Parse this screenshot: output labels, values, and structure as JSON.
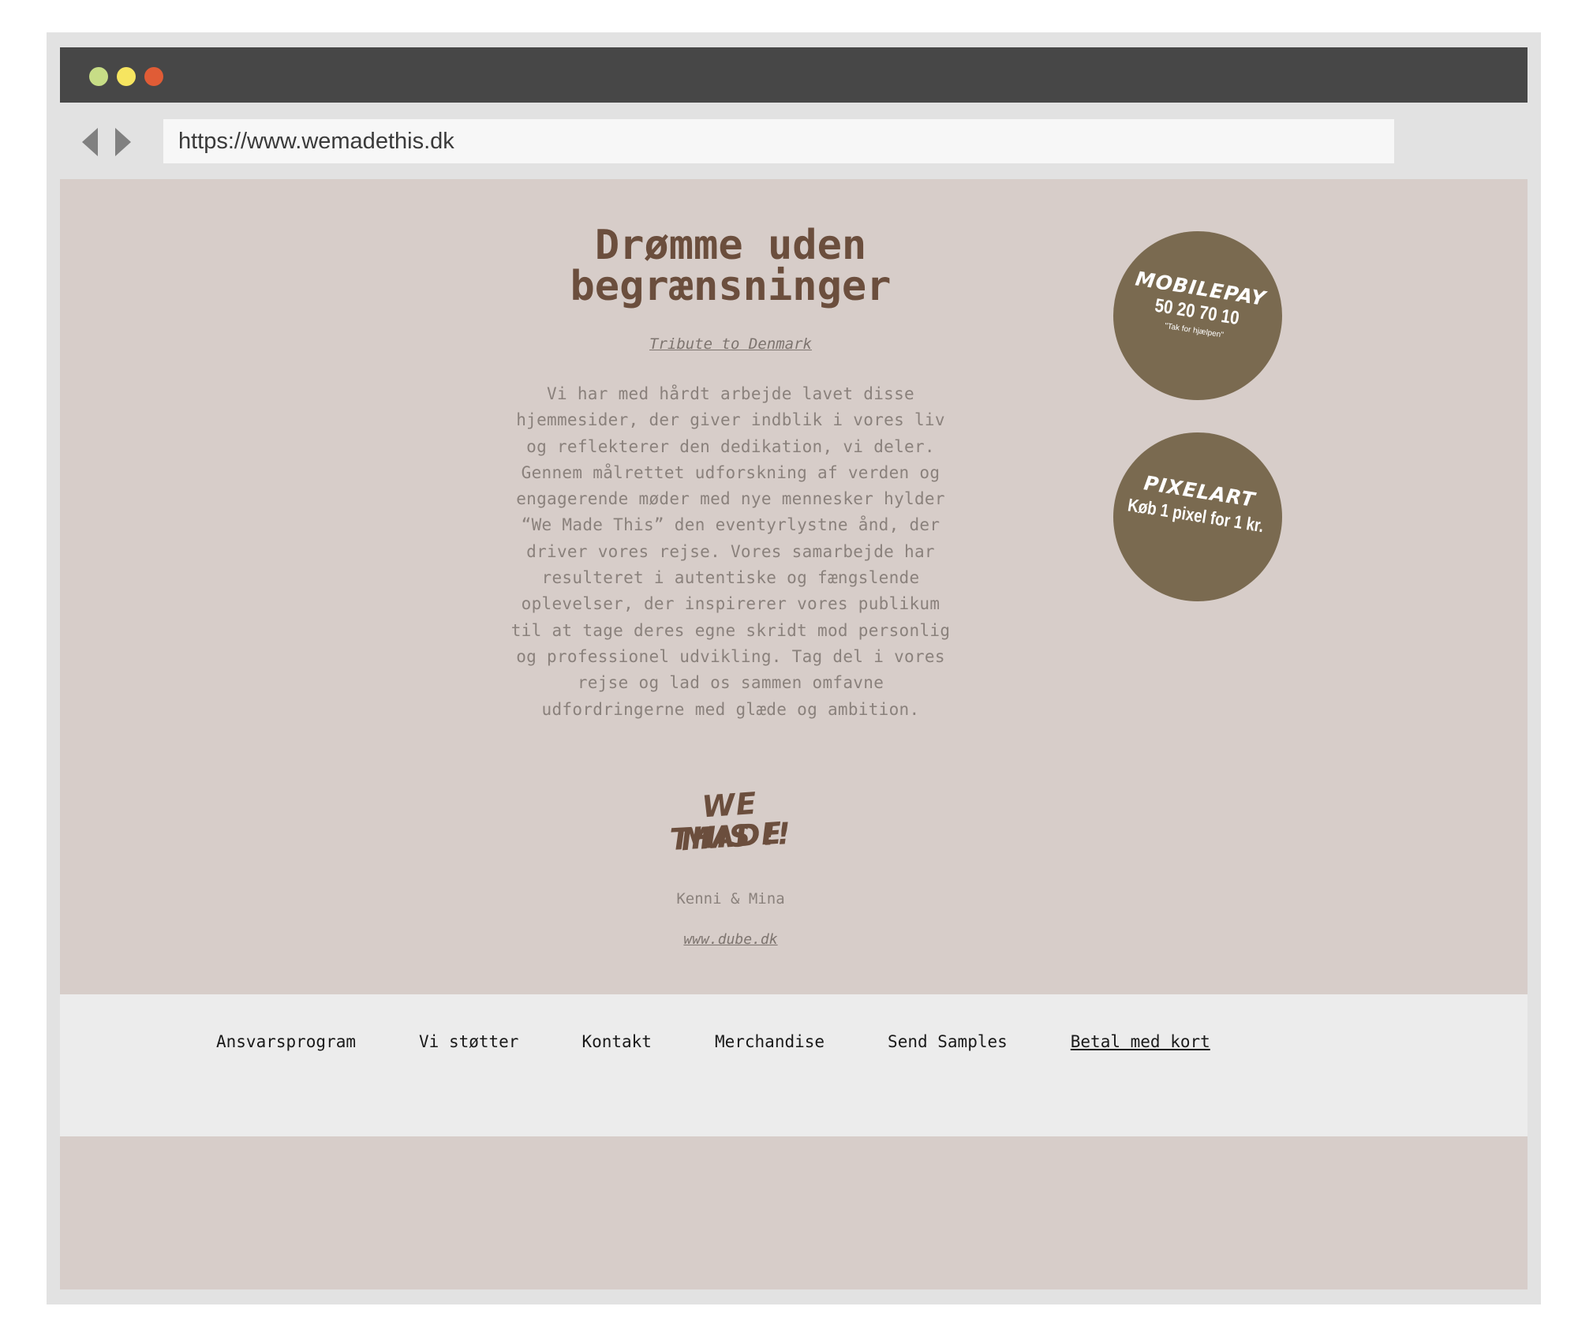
{
  "browser": {
    "url": "https://www.wemadethis.dk",
    "window_dot_colors": [
      "#c7dd86",
      "#f6e560",
      "#e05c36"
    ],
    "nav_icons": [
      "back-arrow-icon",
      "forward-arrow-icon"
    ]
  },
  "hero": {
    "title_line1": "Drømme uden",
    "title_line2": "begrænsninger",
    "subtitle_link": "Tribute to Denmark",
    "body": "Vi har med hårdt arbejde lavet disse hjemmesider, der giver indblik i vores liv og reflekterer den dedikation, vi deler. Gennem målrettet udforskning af verden og engagerende møder med nye mennesker hylder “We Made This” den eventyrlystne ånd, der driver vores rejse. Vores samarbejde har resulteret i autentiske og fængslende oplevelser, der inspirerer vores publikum til at tage deres egne skridt mod personlig og professionel udvikling. Tag del i vores rejse og lad os sammen omfavne udfordringerne med glæde og ambition.",
    "logo_line1": "WE MADE",
    "logo_line2": "THIS !!",
    "authors": "Kenni & Mina",
    "site_link": "www.dube.dk"
  },
  "badges": {
    "mobilepay": {
      "title": "MOBILEPAY",
      "number": "50 20 70 10",
      "note": "\"Tak for hjælpen\""
    },
    "pixelart": {
      "title": "PIXELART",
      "subtitle": "Køb 1 pixel for 1 kr."
    }
  },
  "footer": {
    "links": [
      "Ansvarsprogram",
      "Vi støtter",
      "Kontakt",
      "Merchandise",
      "Send Samples",
      "Betal med kort"
    ]
  },
  "colors": {
    "page_background": "#d7cdc9",
    "accent_brown": "#6b4e3d",
    "badge_brown": "#7a6a50",
    "footer_background": "#ececec",
    "titlebar": "#474747"
  }
}
